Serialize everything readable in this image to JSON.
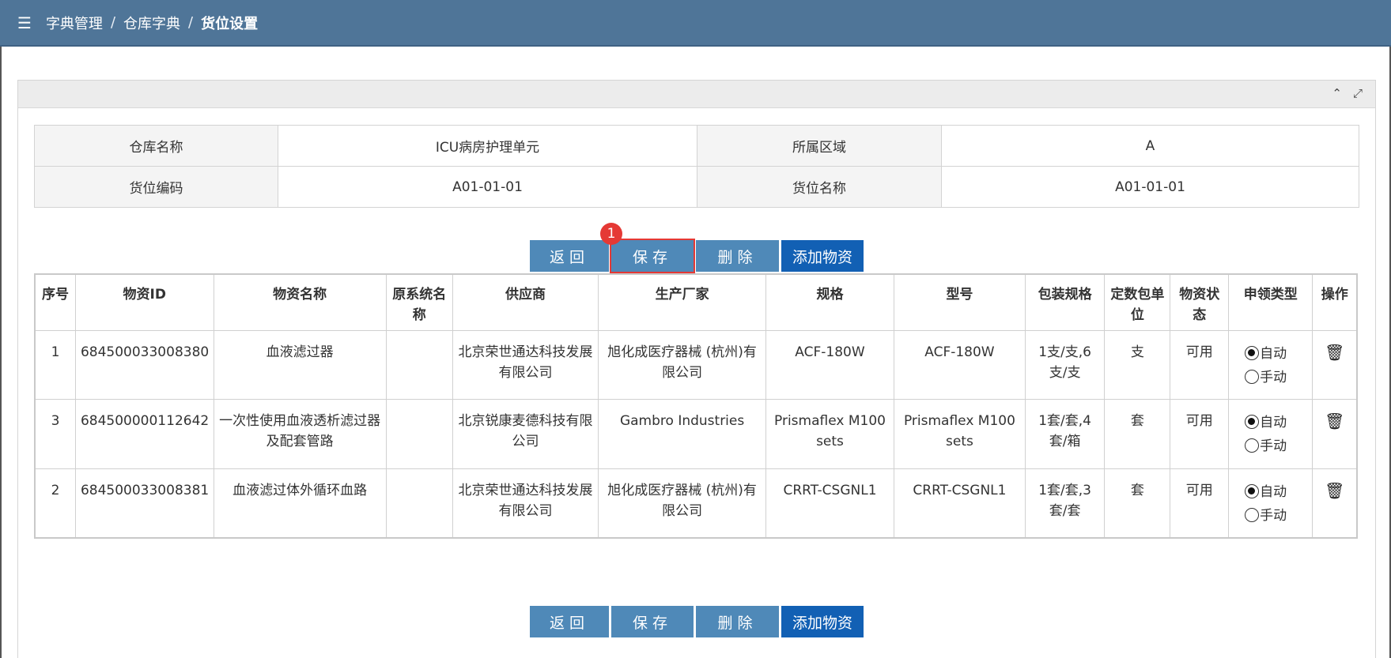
{
  "breadcrumb": {
    "items": [
      "字典管理",
      "仓库字典",
      "货位设置"
    ],
    "sep": "/"
  },
  "icons": {
    "menu": "☰",
    "collapse": "⌃",
    "expand": "⤢",
    "trash": "🗑"
  },
  "info": {
    "warehouse_label": "仓库名称",
    "warehouse_value": "ICU病房护理单元",
    "area_label": "所属区域",
    "area_value": "A",
    "code_label": "货位编码",
    "code_value": "A01-01-01",
    "name_label": "货位名称",
    "name_value": "A01-01-01"
  },
  "buttons": {
    "back": "返回",
    "save": "保存",
    "delete": "删除",
    "add": "添加物资",
    "badge": "1"
  },
  "table": {
    "headers": [
      "序号",
      "物资ID",
      "物资名称",
      "原系统名称",
      "供应商",
      "生产厂家",
      "规格",
      "型号",
      "包装规格",
      "定数包单位",
      "物资状态",
      "申领类型",
      "操作"
    ],
    "radio_auto": "自动",
    "radio_manual": "手动",
    "rows": [
      {
        "seq": "1",
        "id": "684500033008380",
        "name": "血液滤过器",
        "orig": "",
        "supplier": "北京荣世通达科技发展有限公司",
        "maker": "旭化成医疗器械 (杭州)有限公司",
        "spec": "ACF-180W",
        "model": "ACF-180W",
        "pack": "1支/支,6支/支",
        "unit": "支",
        "status": "可用"
      },
      {
        "seq": "3",
        "id": "684500000112642",
        "name": "一次性使用血液透析滤过器及配套管路",
        "orig": "",
        "supplier": "北京锐康麦德科技有限公司",
        "maker": "Gambro Industries",
        "spec": "Prismaflex M100 sets",
        "model": "Prismaflex M100 sets",
        "pack": "1套/套,4套/箱",
        "unit": "套",
        "status": "可用"
      },
      {
        "seq": "2",
        "id": "684500033008381",
        "name": "血液滤过体外循环血路",
        "orig": "",
        "supplier": "北京荣世通达科技发展有限公司",
        "maker": "旭化成医疗器械 (杭州)有限公司",
        "spec": "CRRT-CSGNL1",
        "model": "CRRT-CSGNL1",
        "pack": "1套/套,3套/套",
        "unit": "套",
        "status": "可用"
      }
    ]
  }
}
